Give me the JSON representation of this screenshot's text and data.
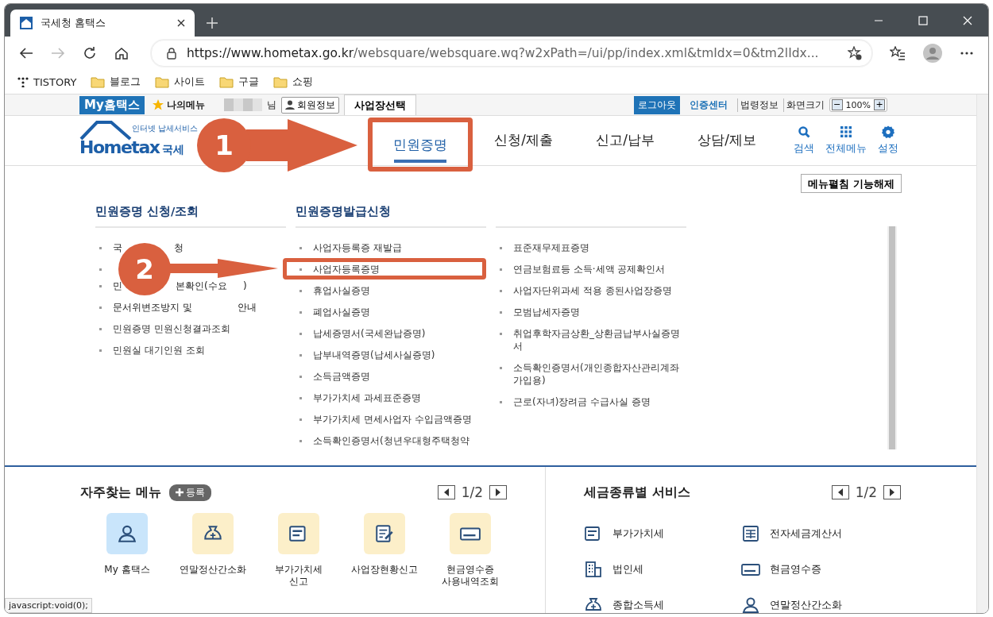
{
  "browser": {
    "tab_title": "국세청 홈택스",
    "url_host": "https://www.hometax.go.kr",
    "url_path": "/websquare/websquare.wq?w2xPath=/ui/pp/index.xml&tmIdx=0&tm2lIdx...",
    "bookmarks": [
      {
        "kind": "app",
        "label": "TISTORY"
      },
      {
        "kind": "folder",
        "label": "블로그"
      },
      {
        "kind": "folder",
        "label": "사이트"
      },
      {
        "kind": "folder",
        "label": "구글"
      },
      {
        "kind": "folder",
        "label": "쇼핑"
      }
    ]
  },
  "utility_bar": {
    "my_hometax": "My홈택스",
    "my_menu": "나의메뉴",
    "user_suffix": "님",
    "member_info": "회원정보",
    "business_select": "사업장선택",
    "logout": "로그아웃",
    "cert_center": "인증센터",
    "links": [
      "법령정보",
      "화면크기"
    ],
    "zoom_out": "−",
    "zoom_level": "100%",
    "zoom_in": "+"
  },
  "header": {
    "logo_tagline": "인터넷 납세서비스",
    "logo_text": "Hometax",
    "logo_org": "국세",
    "nav": [
      {
        "label": "민원증명",
        "selected": true,
        "highlighted": true
      },
      {
        "label": "신청/제출",
        "selected": false,
        "highlighted": false
      },
      {
        "label": "신고/납부",
        "selected": false,
        "highlighted": false
      },
      {
        "label": "상담/제보",
        "selected": false,
        "highlighted": false
      }
    ],
    "tools": [
      {
        "kind": "search",
        "label": "검색"
      },
      {
        "kind": "grid",
        "label": "전체메뉴"
      },
      {
        "kind": "gear",
        "label": "설정"
      }
    ]
  },
  "menu_toggle": "메뉴펼침 기능해제",
  "mega_menu": {
    "columns": [
      {
        "title": "민원증명 신청/조회",
        "items": [
          {
            "kind": "covered",
            "parts": [
              "국",
              "청"
            ],
            "highlighted": false
          },
          {
            "kind": "covered",
            "highlighted": false
          },
          {
            "kind": "covered",
            "parts": [
              "민",
              "본확인(수요",
              ")"
            ],
            "highlighted": false
          },
          {
            "kind": "covered",
            "parts": [
              "문서위변조방지 및",
              "안내"
            ],
            "highlighted": false
          },
          {
            "kind": "text",
            "text": "민원증명 민원신청결과조회",
            "highlighted": false
          },
          {
            "kind": "text",
            "text": "민원실 대기인원 조회",
            "highlighted": false
          }
        ]
      },
      {
        "title": "민원증명발급신청",
        "items": [
          {
            "kind": "text",
            "text": "사업자등록증 재발급",
            "highlighted": false
          },
          {
            "kind": "text",
            "text": "사업자등록증명",
            "highlighted": true
          },
          {
            "kind": "text",
            "text": "휴업사실증명",
            "highlighted": false
          },
          {
            "kind": "text",
            "text": "폐업사실증명",
            "highlighted": false
          },
          {
            "kind": "text",
            "text": "납세증명서(국세완납증명)",
            "highlighted": false
          },
          {
            "kind": "text",
            "text": "납부내역증명(납세사실증명)",
            "highlighted": false
          },
          {
            "kind": "text",
            "text": "소득금액증명",
            "highlighted": false
          },
          {
            "kind": "text",
            "text": "부가가치세 과세표준증명",
            "highlighted": false
          },
          {
            "kind": "text",
            "text": "부가가치세 면세사업자 수입금액증명",
            "highlighted": false
          },
          {
            "kind": "text",
            "text": "소득확인증명서(청년우대형주택청약",
            "highlighted": false
          }
        ]
      },
      {
        "items": [
          {
            "kind": "text",
            "text": "표준재무제표증명",
            "highlighted": false
          },
          {
            "kind": "text",
            "text": "연금보험료등 소득·세액 공제확인서",
            "highlighted": false
          },
          {
            "kind": "text",
            "text": "사업자단위과세 적용 종된사업장증명",
            "highlighted": false
          },
          {
            "kind": "text",
            "text": "모범납세자증명",
            "highlighted": false
          },
          {
            "kind": "text",
            "text": "취업후학자금상환_상환금납부사실증명서",
            "highlighted": false
          },
          {
            "kind": "text",
            "text": "소득확인증명서(개인종합자산관리계좌 가입용)",
            "highlighted": false
          },
          {
            "kind": "text",
            "text": "근로(자녀)장려금 수급사실 증명",
            "highlighted": false
          }
        ]
      }
    ]
  },
  "annotations": [
    {
      "kind": "step",
      "number": "1"
    },
    {
      "kind": "step",
      "number": "2"
    }
  ],
  "frequent_menu": {
    "title": "자주찾는 메뉴",
    "add_button": "등록",
    "page": "1/2",
    "items": [
      {
        "kind": "person",
        "label": "My 홈택스",
        "color": "#c9e5fb"
      },
      {
        "kind": "moneybag",
        "label": "연말정산간소화",
        "color": "#fcefc9"
      },
      {
        "kind": "vat",
        "label": "부가가치세\n신고",
        "color": "#fcefc9"
      },
      {
        "kind": "report",
        "label": "사업장현황신고",
        "color": "#fcefc9"
      },
      {
        "kind": "receipt",
        "label": "현금영수증\n사용내역조회",
        "color": "#fcefc9"
      }
    ]
  },
  "tax_services": {
    "title": "세금종류별 서비스",
    "page": "1/2",
    "items": [
      {
        "kind": "vat",
        "label": "부가가치세"
      },
      {
        "kind": "invoice",
        "label": "전자세금계산서"
      },
      {
        "kind": "building",
        "label": "법인세"
      },
      {
        "kind": "receipt",
        "label": "현금영수증"
      },
      {
        "kind": "moneybag",
        "label": "종합소득세"
      },
      {
        "kind": "person",
        "label": "연말정산간소화"
      }
    ]
  },
  "status_bubble": "javascript:void(0);"
}
